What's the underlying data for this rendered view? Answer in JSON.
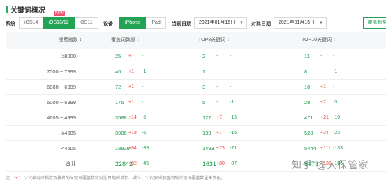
{
  "title": "关键词概况",
  "filters": {
    "system_label": "系统",
    "systems": [
      "iOS14",
      "iOS13/12",
      "iOS11"
    ],
    "new_badge": "NEW",
    "device_label": "设备",
    "devices": [
      "iPhone",
      "iPad"
    ],
    "current_date_label": "当前日期",
    "current_date": "2021年01月16日",
    "compare_date_label": "对比日期",
    "compare_date": "2021年01月15日",
    "caret": "▼",
    "export_label": "覆盖趋势"
  },
  "colors": {
    "accent": "#23a455",
    "up": "#e74c3c",
    "down": "#1d9a4d"
  },
  "table": {
    "headers": [
      "搜索指数 ↕",
      "覆盖词数量 ↕",
      "TOP3关键词 ↕",
      "TOP10关键词 ↕"
    ],
    "rows": [
      {
        "label": "≥8000",
        "cells": [
          {
            "v": "25",
            "u": "+1",
            "d": "-"
          },
          {
            "v": "2",
            "u": "-",
            "d": "-"
          },
          {
            "v": "11",
            "u": "-",
            "d": "-"
          }
        ]
      },
      {
        "label": "7000 ~ 7999",
        "cells": [
          {
            "v": "46",
            "u": "+1",
            "d": "-1"
          },
          {
            "v": "1",
            "u": "-",
            "d": "-"
          },
          {
            "v": "8",
            "u": "-",
            "d": "-1"
          }
        ]
      },
      {
        "label": "6000 ~ 6999",
        "cells": [
          {
            "v": "72",
            "u": "+1",
            "d": "-"
          },
          {
            "v": "3",
            "u": "-",
            "d": "-"
          },
          {
            "v": "10",
            "u": "+1",
            "d": "-"
          }
        ]
      },
      {
        "label": "5000 ~ 5999",
        "cells": [
          {
            "v": "175",
            "u": "+1",
            "d": "-"
          },
          {
            "v": "5",
            "u": "-",
            "d": "-1"
          },
          {
            "v": "28",
            "u": "+2",
            "d": "-3"
          }
        ]
      },
      {
        "label": "4605 ~ 4999",
        "cells": [
          {
            "v": "3588",
            "u": "+14",
            "d": "-5"
          },
          {
            "v": "127",
            "u": "+7",
            "d": "-15"
          },
          {
            "v": "471",
            "u": "+21",
            "d": "-19"
          }
        ]
      },
      {
        "label": "≥4605",
        "cells": [
          {
            "v": "3906",
            "u": "+18",
            "d": "-6"
          },
          {
            "v": "138",
            "u": "+7",
            "d": "-16"
          },
          {
            "v": "528",
            "u": "+24",
            "d": "-23"
          }
        ]
      },
      {
        "label": "<4605",
        "cells": [
          {
            "v": "18936",
            "u": "+64",
            "d": "-39"
          },
          {
            "v": "1493",
            "u": "+73",
            "d": "-71"
          },
          {
            "v": "5444",
            "u": "+111",
            "d": "-133"
          }
        ]
      },
      {
        "label": "合计",
        "cells": [
          {
            "v": "22842",
            "u": "+82",
            "d": "-45"
          },
          {
            "v": "1631",
            "u": "+80",
            "d": "-87"
          },
          {
            "v": "5973",
            "u": "+135",
            "d": "-156"
          }
        ]
      }
    ]
  },
  "note": {
    "prefix": "注：",
    "highlight": "\"+\"",
    "text": "、\"-\"代表对应指数及排名的关键词覆盖数较对比日期的增加、减少。\"-\"代表当前区间的关键词覆盖数量未变化。"
  },
  "watermark": "知乎 @大保管家"
}
